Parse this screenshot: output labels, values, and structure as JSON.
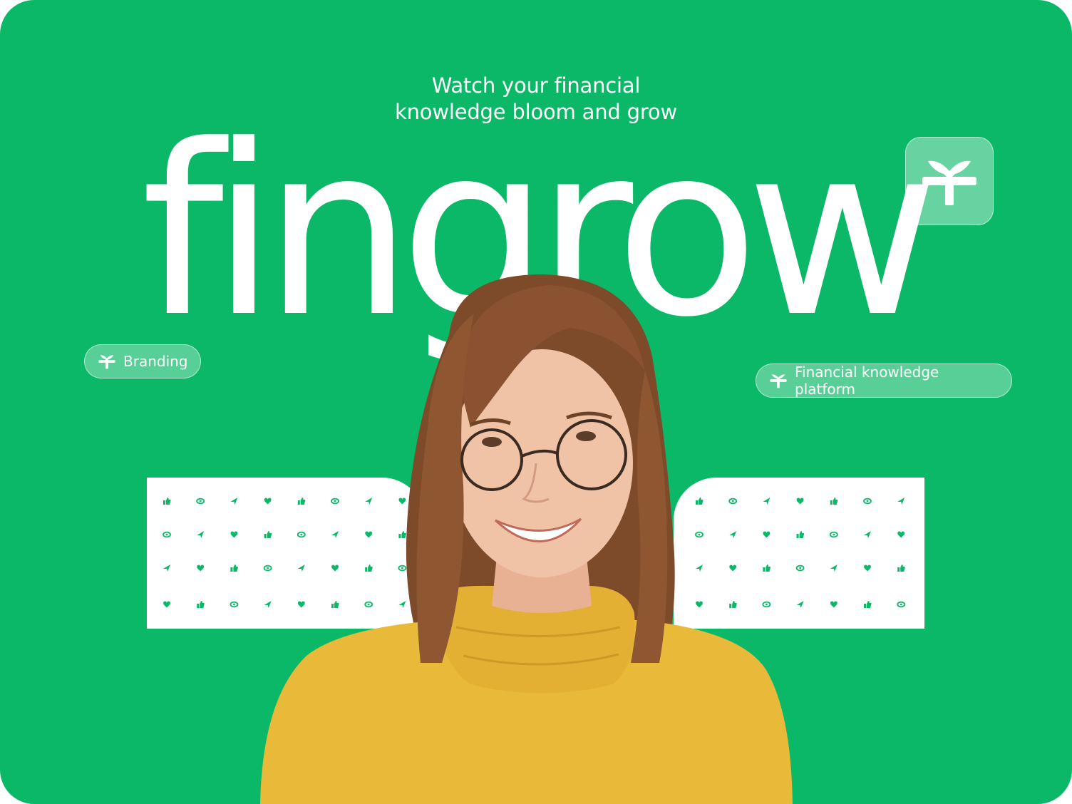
{
  "hero": {
    "tagline_line1": "Watch your financial",
    "tagline_line2": "knowledge bloom and grow",
    "wordmark": "fingrow"
  },
  "tags": {
    "branding": "Branding",
    "platform": "Financial knowledge platform"
  },
  "icons": {
    "brand": "fingrow-leaf-icon",
    "pattern": [
      "thumbs-up-icon",
      "eye-icon",
      "send-icon",
      "heart-icon"
    ]
  },
  "colors": {
    "brand_green": "#0bb868",
    "white": "#ffffff",
    "sweater": "#e9b93a",
    "hair": "#8a5230"
  }
}
